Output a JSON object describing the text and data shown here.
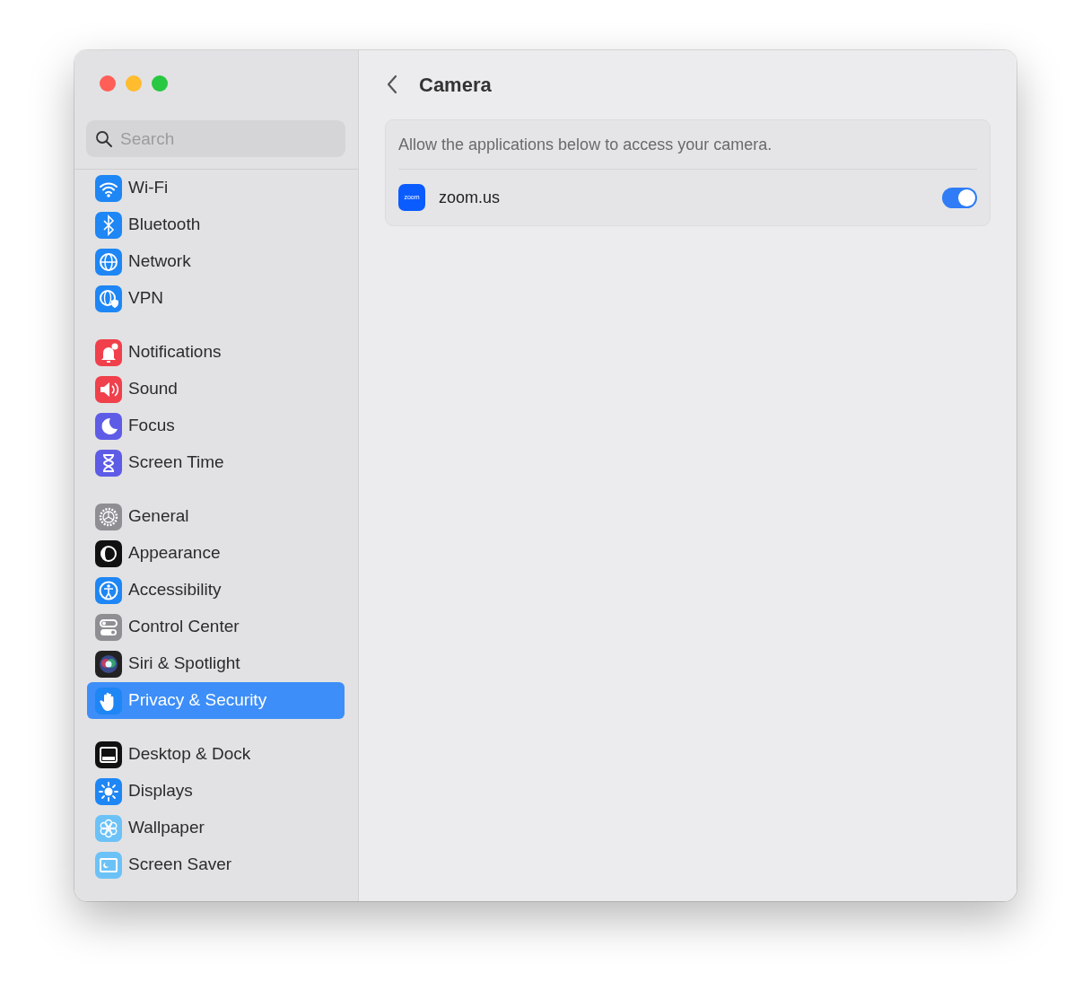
{
  "sidebar": {
    "search": {
      "placeholder": "Search"
    },
    "groups": [
      {
        "items": [
          {
            "label": "Wi-Fi",
            "selected": false
          },
          {
            "label": "Bluetooth",
            "selected": false
          },
          {
            "label": "Network",
            "selected": false
          },
          {
            "label": "VPN",
            "selected": false
          }
        ]
      },
      {
        "items": [
          {
            "label": "Notifications",
            "selected": false
          },
          {
            "label": "Sound",
            "selected": false
          },
          {
            "label": "Focus",
            "selected": false
          },
          {
            "label": "Screen Time",
            "selected": false
          }
        ]
      },
      {
        "items": [
          {
            "label": "General",
            "selected": false
          },
          {
            "label": "Appearance",
            "selected": false
          },
          {
            "label": "Accessibility",
            "selected": false
          },
          {
            "label": "Control Center",
            "selected": false
          },
          {
            "label": "Siri & Spotlight",
            "selected": false
          },
          {
            "label": "Privacy & Security",
            "selected": true
          }
        ]
      },
      {
        "items": [
          {
            "label": "Desktop & Dock",
            "selected": false
          },
          {
            "label": "Displays",
            "selected": false
          },
          {
            "label": "Wallpaper",
            "selected": false
          },
          {
            "label": "Screen Saver",
            "selected": false
          }
        ]
      }
    ]
  },
  "main": {
    "title": "Camera",
    "description": "Allow the applications below to access your camera.",
    "apps": [
      {
        "name": "zoom.us",
        "icon_text": "zoom",
        "on": true
      }
    ]
  }
}
